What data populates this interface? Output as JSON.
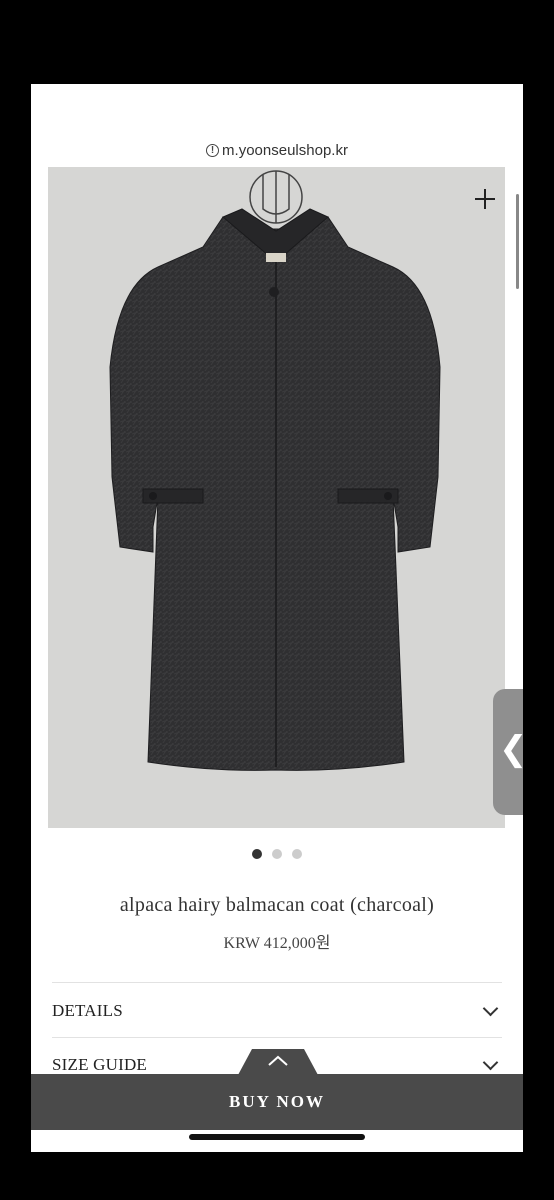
{
  "browser": {
    "url": "m.yoonseulshop.kr"
  },
  "gallery": {
    "total_images": 3,
    "active_index": 0
  },
  "product": {
    "name": "alpaca hairy balmacan coat (charcoal)",
    "price": "KRW 412,000원"
  },
  "sections": [
    {
      "label": "DETAILS"
    },
    {
      "label": "SIZE GUIDE"
    }
  ],
  "actions": {
    "buy_label": "BUY NOW"
  },
  "colors": {
    "buy_bar": "#4a4a4a",
    "coat": "#2f2f31",
    "photo_bg": "#d6d6d4"
  }
}
